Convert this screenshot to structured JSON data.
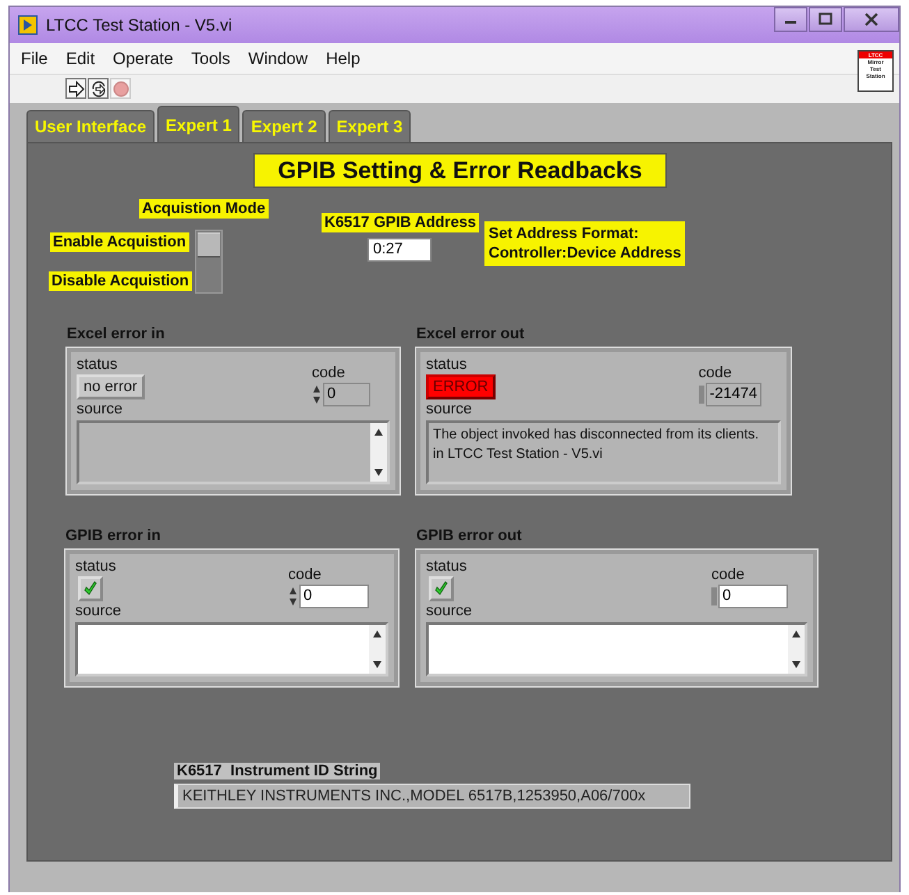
{
  "window": {
    "title": "LTCC Test Station - V5.vi"
  },
  "menu": [
    "File",
    "Edit",
    "Operate",
    "Tools",
    "Window",
    "Help"
  ],
  "toolbar": [
    {
      "kind": "run",
      "disabled": false
    },
    {
      "kind": "run_continuous",
      "disabled": false
    },
    {
      "kind": "abort",
      "disabled": true
    }
  ],
  "vi_icon": {
    "banner": "LTCC",
    "lines": [
      "Mirror",
      "Test",
      "Station"
    ]
  },
  "tabs": [
    {
      "label": "User Interface",
      "selected": false
    },
    {
      "label": "Expert 1",
      "selected": true
    },
    {
      "label": "Expert 2",
      "selected": false
    },
    {
      "label": "Expert 3",
      "selected": false
    }
  ],
  "heading": "GPIB Setting & Error Readbacks",
  "acquisition": {
    "title": "Acquistion Mode",
    "on_label": "Enable Acquistion",
    "off_label": "Disable Acquistion",
    "enabled": true
  },
  "gpib_address": {
    "label": "K6517 GPIB Address",
    "value": "0:27"
  },
  "address_note": [
    "Set Address Format:",
    "Controller:Device Address"
  ],
  "error_clusters": [
    {
      "title": "Excel error in",
      "status_label": "status",
      "status": {
        "kind": "button",
        "error": false,
        "text": "no error"
      },
      "code_label": "code",
      "code": "0",
      "incrementer": true,
      "source_label": "source",
      "editable": false,
      "scrollbar": true
    },
    {
      "title": "Excel error out",
      "status_label": "status",
      "status": {
        "kind": "button",
        "error": true,
        "text": "ERROR"
      },
      "code_label": "code",
      "code": "-21474",
      "incrementer": false,
      "source_label": "source",
      "source": [
        "The object invoked has disconnected from its clients.",
        "in LTCC Test Station - V5.vi"
      ],
      "editable": false,
      "scrollbar": false
    },
    {
      "title": "GPIB error in",
      "status_label": "status",
      "status": {
        "kind": "check",
        "error": false
      },
      "code_label": "code",
      "code": "0",
      "incrementer": true,
      "source_label": "source",
      "editable": true,
      "scrollbar": true
    },
    {
      "title": "GPIB error out",
      "status_label": "status",
      "status": {
        "kind": "check",
        "error": false
      },
      "code_label": "code",
      "code": "0",
      "incrementer": false,
      "source_label": "source",
      "editable": true,
      "scrollbar": true
    }
  ],
  "id_string": {
    "label": "K6517  Instrument ID String",
    "value": "KEITHLEY INSTRUMENTS INC.,MODEL 6517B,1253950,A06/700x"
  }
}
